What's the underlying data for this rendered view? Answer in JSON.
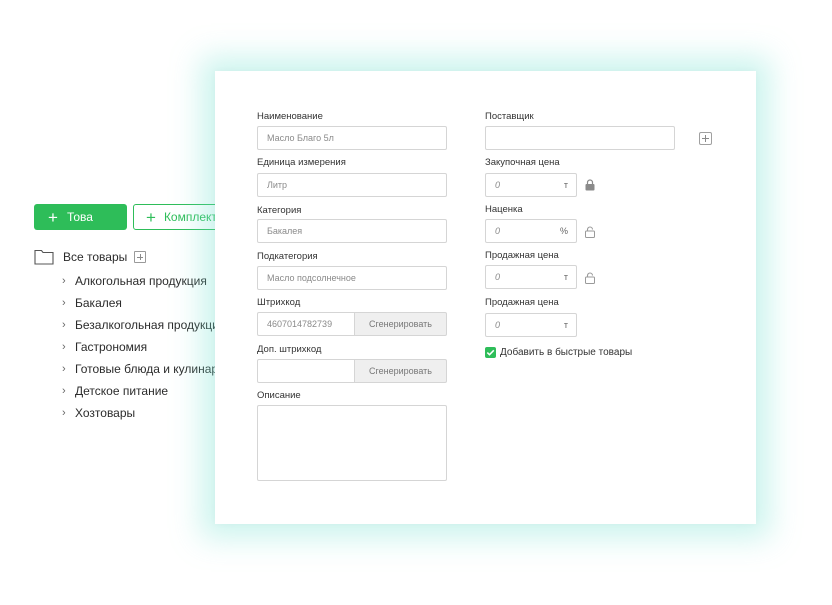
{
  "sidebar": {
    "add_product_label": "Това",
    "add_kit_label": "Комплект",
    "root_label": "Все товары",
    "categories": [
      "Алкогольная продукция",
      "Бакалея",
      "Безалкогольная продукция",
      "Гастрономия",
      "Готовые блюда и кулинария",
      "Детское питание",
      "Хозтовары"
    ]
  },
  "form": {
    "name": {
      "label": "Наименование",
      "value": "Масло Благо 5л"
    },
    "unit": {
      "label": "Единица измерения",
      "value": "Литр"
    },
    "category": {
      "label": "Категория",
      "value": "Бакалея"
    },
    "subcategory": {
      "label": "Подкатегория",
      "value": "Масло подсолнечное"
    },
    "barcode": {
      "label": "Штрихкод",
      "value": "4607014782739",
      "button": "Сгенерировать"
    },
    "extra_barcode": {
      "label": "Доп. штрихкод",
      "value": "",
      "button": "Сгенерировать"
    },
    "description": {
      "label": "Описание",
      "value": ""
    },
    "supplier": {
      "label": "Поставщик",
      "value": ""
    },
    "purchase_price": {
      "label": "Закупочная цена",
      "value": "0",
      "unit": "т"
    },
    "markup": {
      "label": "Наценка",
      "value": "0",
      "unit": "%"
    },
    "sale_price_1": {
      "label": "Продажная цена",
      "value": "0",
      "unit": "т"
    },
    "sale_price_2": {
      "label": "Продажная цена",
      "value": "0",
      "unit": "т"
    },
    "quick_products": {
      "label": "Добавить в быстрые товары",
      "checked": true
    }
  },
  "colors": {
    "accent": "#2ebd59",
    "glow": "#78e2d2"
  }
}
